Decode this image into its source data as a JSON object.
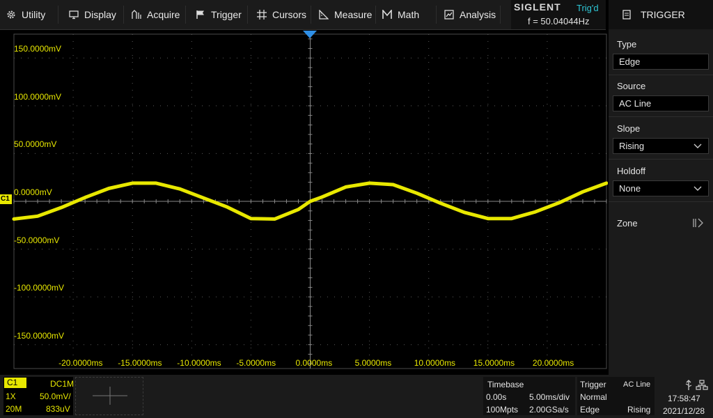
{
  "menu": {
    "utility": "Utility",
    "display": "Display",
    "acquire": "Acquire",
    "trigger": "Trigger",
    "cursors": "Cursors",
    "measure": "Measure",
    "math": "Math",
    "analysis": "Analysis"
  },
  "brand": {
    "logo": "SIGLENT",
    "trig_status": "Trig'd",
    "frequency": "f = 50.04044Hz"
  },
  "right_panel": {
    "title": "TRIGGER",
    "type_label": "Type",
    "type_value": "Edge",
    "source_label": "Source",
    "source_value": "AC Line",
    "slope_label": "Slope",
    "slope_value": "Rising",
    "holdoff_label": "Holdoff",
    "holdoff_value": "None",
    "zone_label": "Zone"
  },
  "graticule": {
    "y_labels": [
      "150.0000mV",
      "100.0000mV",
      "50.0000mV",
      "0.0000mV",
      "-50.0000mV",
      "-100.0000mV",
      "-150.0000mV"
    ],
    "x_labels": [
      "-20.0000ms",
      "-15.0000ms",
      "-10.0000ms",
      "-5.0000ms",
      "0.0000ms",
      "5.0000ms",
      "10.0000ms",
      "15.0000ms",
      "20.0000ms"
    ],
    "channel_marker": "C1"
  },
  "chart_data": {
    "type": "line",
    "series": [
      {
        "name": "C1",
        "x": [
          -25,
          -23,
          -21,
          -19,
          -17,
          -15,
          -13,
          -11,
          -9,
          -7,
          -5,
          -3,
          -1,
          0,
          1,
          3,
          5,
          7,
          9,
          11,
          13,
          15,
          17,
          19,
          21,
          23,
          25
        ],
        "values": [
          -18.5,
          -15.5,
          -6.5,
          4,
          13.5,
          19,
          19,
          13,
          3.5,
          -6,
          -18,
          -18.5,
          -8.5,
          0,
          4.5,
          15,
          19,
          17.5,
          8.5,
          -2,
          -11.5,
          -18,
          -18,
          -11,
          -1.5,
          10,
          19
        ]
      }
    ],
    "xlim": [
      -25,
      25
    ],
    "ylim": [
      -175,
      175
    ],
    "xlabel": "",
    "ylabel": "",
    "grid": true,
    "trace_color": "#e8e800"
  },
  "status": {
    "channel": {
      "tag": "C1",
      "coupling": "DC1M",
      "probe": "1X",
      "scale": "50.0mV/",
      "bandwidth": "20M",
      "offset": "833uV"
    },
    "timebase": {
      "title": "Timebase",
      "delay": "0.00s",
      "scale": "5.00ms/div",
      "memory": "100Mpts",
      "sample_rate": "2.00GSa/s"
    },
    "trigger": {
      "title": "Trigger",
      "source": "AC Line",
      "mode": "Normal",
      "type": "Edge",
      "slope": "Rising"
    },
    "clock": {
      "time": "17:58:47",
      "date": "2021/12/28"
    }
  }
}
